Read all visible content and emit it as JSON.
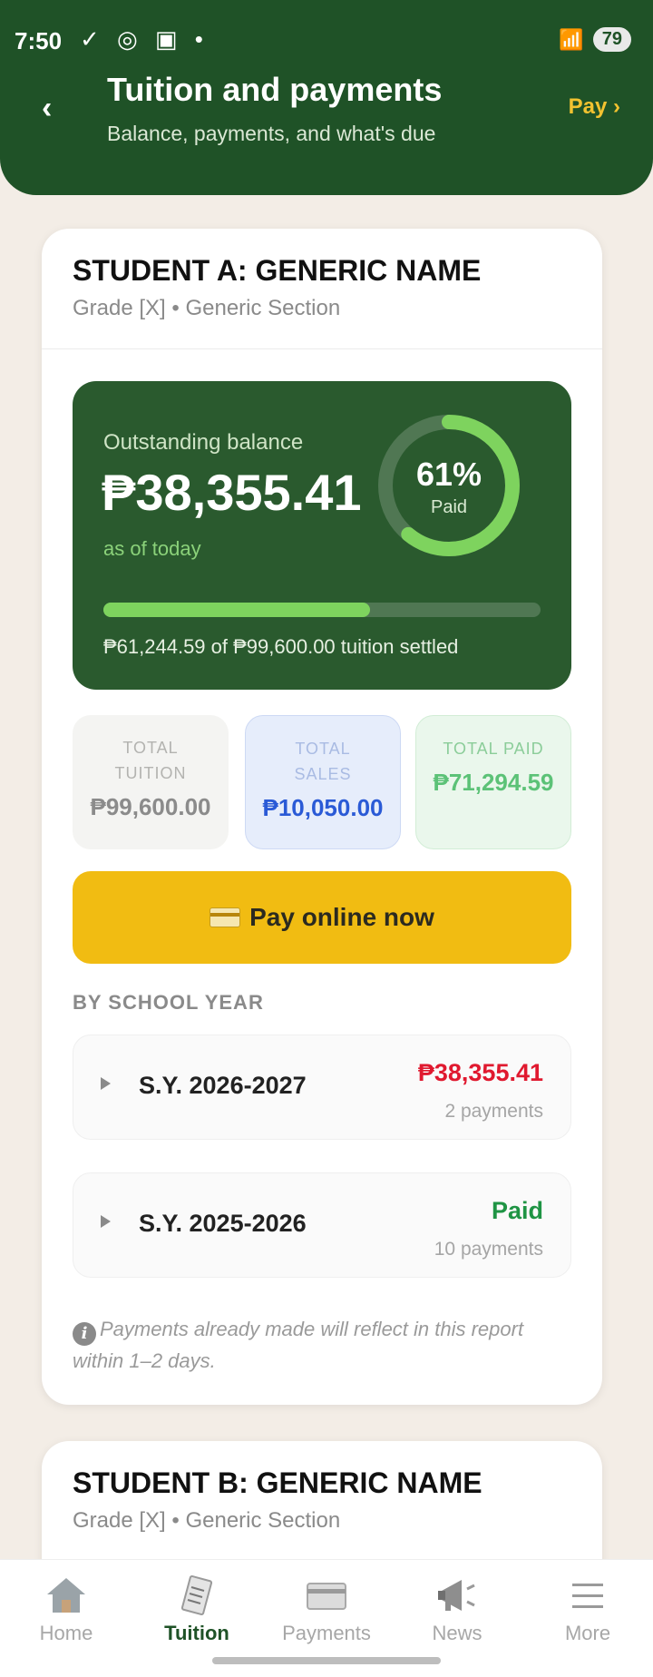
{
  "status_bar": {
    "time": "7:50",
    "left_icons": "✓ ◎ ▣ •",
    "signal": "📶",
    "battery": "79"
  },
  "header": {
    "back": "‹",
    "title": "Tuition and payments",
    "subtitle": "Balance, payments, and what's due",
    "pay_link": "Pay ›"
  },
  "student_a": {
    "name": "STUDENT A: GENERIC NAME",
    "grade": "Grade [X] • Generic Section",
    "balance": {
      "label": "Outstanding balance",
      "amount": "₱38,355.41",
      "as_of": "as of today",
      "percent_paid": 61,
      "percent_label": "61%",
      "paid_label": "Paid",
      "settled_text": "₱61,244.59 of ₱99,600.00 tuition settled"
    },
    "stats": [
      {
        "label": "TOTAL TUITION",
        "value": "₱99,600.00"
      },
      {
        "label": "TOTAL SALES",
        "value": "₱10,050.00"
      },
      {
        "label": "TOTAL PAID",
        "value": "₱71,294.59"
      }
    ],
    "pay_button": "Pay online now",
    "section_label": "BY SCHOOL YEAR",
    "years": [
      {
        "name": "S.Y. 2026-2027",
        "amount": "₱38,355.41",
        "count": "2 payments"
      },
      {
        "name": "S.Y. 2025-2026",
        "amount": "Paid",
        "count": "10 payments"
      }
    ],
    "note": "Payments already made will reflect in this report within 1–2 days."
  },
  "student_b": {
    "name": "STUDENT B: GENERIC NAME",
    "grade": "Grade [X] • Generic Section"
  },
  "nav": {
    "items": [
      {
        "label": "Home",
        "icon": "home-icon"
      },
      {
        "label": "Tuition",
        "icon": "receipt-icon"
      },
      {
        "label": "Payments",
        "icon": "credit-card-icon"
      },
      {
        "label": "News",
        "icon": "megaphone-icon"
      },
      {
        "label": "More",
        "icon": "menu-icon"
      }
    ],
    "active": "Tuition"
  },
  "colors": {
    "brand_green": "#1f5227",
    "accent_yellow": "#f1bc12",
    "due_red": "#e0192f",
    "paid_green": "#1f9444"
  }
}
